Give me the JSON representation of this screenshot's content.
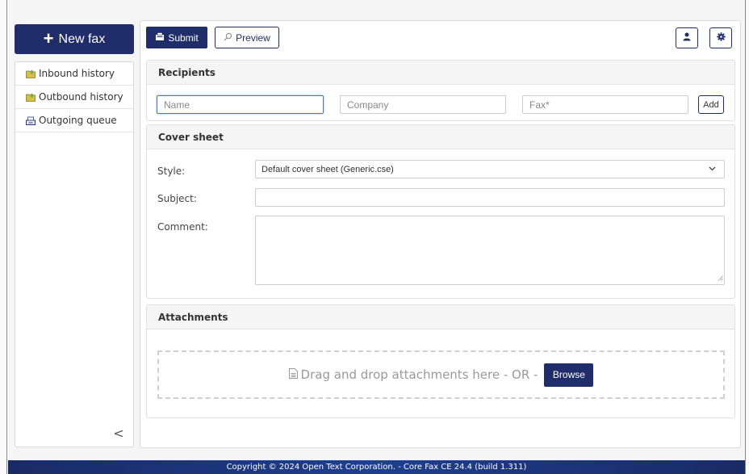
{
  "sidebar": {
    "new_fax_label": "New fax",
    "items": [
      {
        "label": "Inbound history",
        "icon": "folder-inbound-icon"
      },
      {
        "label": "Outbound history",
        "icon": "folder-outbound-icon"
      },
      {
        "label": "Outgoing queue",
        "icon": "outbox-tray-icon"
      }
    ],
    "collapse_glyph": "<"
  },
  "toolbar": {
    "submit_label": "Submit",
    "preview_label": "Preview",
    "user_icon": "user-icon",
    "settings_icon": "gear-icon"
  },
  "recipients": {
    "title": "Recipients",
    "name_placeholder": "Name",
    "company_placeholder": "Company",
    "fax_placeholder": "Fax*",
    "add_label": "Add"
  },
  "cover_sheet": {
    "title": "Cover sheet",
    "style_label": "Style:",
    "style_value": "Default cover sheet (Generic.cse)",
    "subject_label": "Subject:",
    "subject_value": "",
    "comment_label": "Comment:",
    "comment_value": ""
  },
  "attachments": {
    "title": "Attachments",
    "drop_text": "Drag and drop attachments here - OR -",
    "browse_label": "Browse"
  },
  "footer": {
    "text": "Copyright © 2024 Open Text Corporation. - Core Fax CE 24.4 (build 1.311)"
  },
  "colors": {
    "brand": "#1f2d6b",
    "footer": "#1e3f8f",
    "focus": "#4a78c9",
    "folder_icon": "#c9b23a"
  }
}
